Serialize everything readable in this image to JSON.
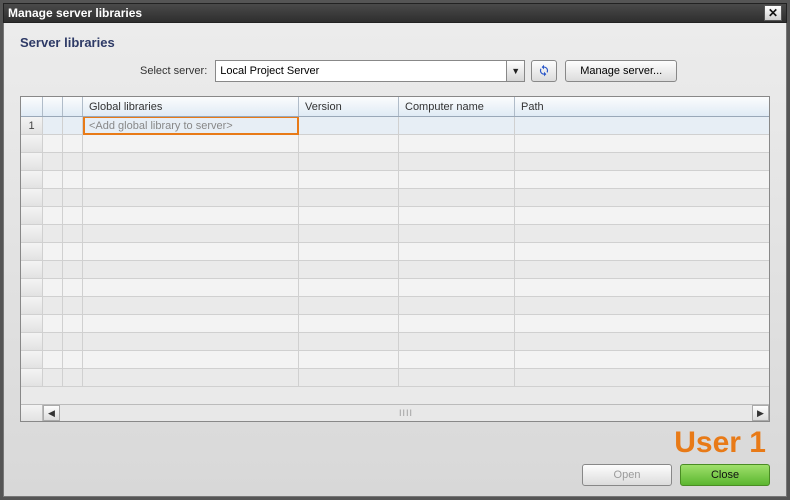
{
  "window": {
    "title": "Manage server libraries",
    "close_icon": "✕"
  },
  "section": {
    "heading": "Server libraries",
    "select_label": "Select server:",
    "server_dropdown": {
      "selected": "Local Project Server"
    },
    "manage_button": "Manage server..."
  },
  "table": {
    "headers": {
      "global_libraries": "Global libraries",
      "version": "Version",
      "computer_name": "Computer name",
      "path": "Path"
    },
    "rows": [
      {
        "num": "1",
        "placeholder": "<Add global library to server>"
      }
    ]
  },
  "annotation": {
    "user_label": "User 1"
  },
  "footer": {
    "open": "Open",
    "close": "Close"
  },
  "colors": {
    "highlight": "#e87a17",
    "close_btn": "#5bb62f"
  }
}
